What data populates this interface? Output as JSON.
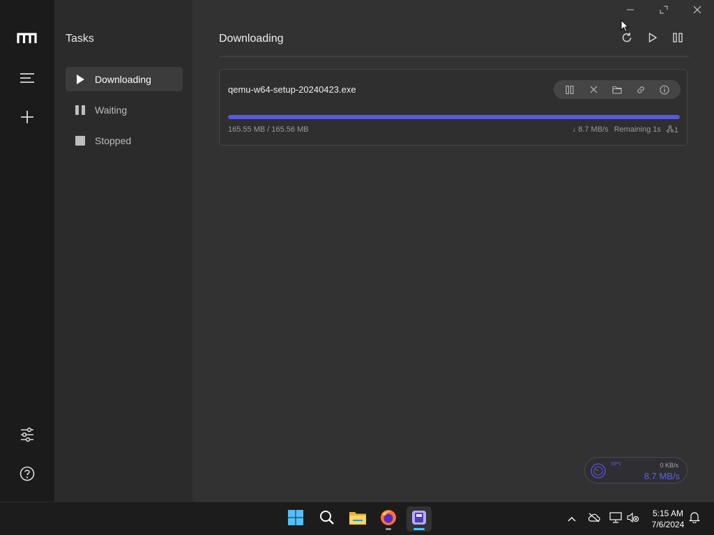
{
  "window": {
    "controls": [
      "minimize",
      "maximize",
      "close"
    ]
  },
  "rail": {
    "icons": [
      "app-logo-icon",
      "menu-icon",
      "add-task-icon",
      "preferences-icon",
      "help-icon"
    ]
  },
  "sidebar": {
    "title": "Tasks",
    "items": [
      {
        "label": "Downloading",
        "icon": "play-icon",
        "active": true
      },
      {
        "label": "Waiting",
        "icon": "pause-icon",
        "active": false
      },
      {
        "label": "Stopped",
        "icon": "stop-icon",
        "active": false
      }
    ]
  },
  "main": {
    "title": "Downloading",
    "header_actions": [
      "refresh-icon",
      "resume-all-icon",
      "pause-all-icon"
    ]
  },
  "task": {
    "file_name": "qemu-w64-setup-20240423.exe",
    "actions": [
      "pause-icon",
      "remove-icon",
      "folder-icon",
      "link-icon",
      "info-icon"
    ],
    "progress_fraction": 0.9999,
    "sizes": "165.55 MB / 165.56 MB",
    "speed": "↓ 8.7 MB/s",
    "remaining": "Remaining 1s",
    "connections": "1"
  },
  "speedometer": {
    "mode": "MPV",
    "upload": "0 KB/s",
    "download": "8.7 MB/s"
  },
  "taskbar": {
    "time": "5:15 AM",
    "date": "7/6/2024"
  },
  "colors": {
    "accent": "#5a5ad6",
    "rail_bg": "#1b1b1b",
    "sidebar_bg": "#2b2b2b",
    "main_bg": "#323232",
    "taskbar_bg": "#1c1c1c"
  }
}
